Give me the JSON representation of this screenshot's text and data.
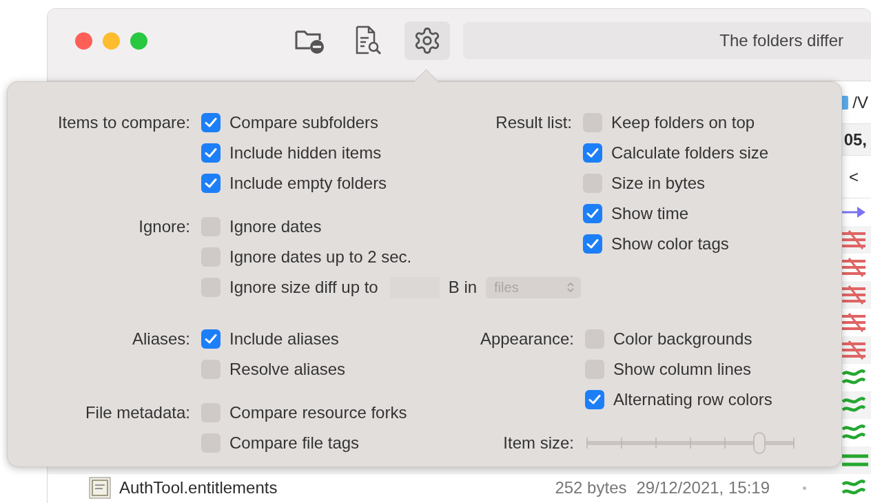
{
  "toolbar": {
    "buttons": [
      {
        "selected": false
      },
      {
        "selected": false
      },
      {
        "selected": true
      }
    ],
    "status": "The folders differ"
  },
  "background": {
    "path": "/V",
    "summary": "05,",
    "column_header": "<",
    "rows": [
      {
        "kind": "arrow"
      },
      {
        "kind": "different"
      },
      {
        "kind": "different"
      },
      {
        "kind": "different"
      },
      {
        "kind": "different"
      },
      {
        "kind": "different"
      },
      {
        "kind": "similar"
      },
      {
        "kind": "similar"
      },
      {
        "kind": "similar"
      },
      {
        "kind": "equal"
      },
      {
        "kind": "similar",
        "name": "AuthTool.entitlements",
        "size": "252 bytes",
        "date": "29/12/2021, 15:19"
      }
    ]
  },
  "popover": {
    "left": [
      {
        "label": "Items to compare:",
        "items": [
          {
            "kind": "checkbox",
            "label": "Compare subfolders",
            "checked": true
          },
          {
            "kind": "checkbox",
            "label": "Include hidden items",
            "checked": true
          },
          {
            "kind": "checkbox",
            "label": "Include empty folders",
            "checked": true
          }
        ]
      },
      {
        "label": "Ignore:",
        "items": [
          {
            "kind": "checkbox",
            "label": "Ignore dates",
            "checked": false
          },
          {
            "kind": "checkbox",
            "label": "Ignore dates up to 2 sec.",
            "checked": false
          },
          {
            "kind": "size",
            "label": "Ignore size diff up to",
            "checked": false,
            "unit": "B in",
            "select": {
              "value": "files",
              "disabled": true
            }
          }
        ]
      }
    ],
    "right": [
      {
        "label": "Result list:",
        "items": [
          {
            "kind": "checkbox",
            "label": "Keep folders on top",
            "checked": false
          },
          {
            "kind": "checkbox",
            "label": "Calculate folders size",
            "checked": true
          },
          {
            "kind": "checkbox",
            "label": "Size in bytes",
            "checked": false
          },
          {
            "kind": "checkbox",
            "label": "Show time",
            "checked": true
          },
          {
            "kind": "checkbox",
            "label": "Show color tags",
            "checked": true
          }
        ]
      }
    ],
    "left2": [
      {
        "label": "Aliases:",
        "items": [
          {
            "kind": "checkbox",
            "label": "Include aliases",
            "checked": true
          },
          {
            "kind": "checkbox",
            "label": "Resolve aliases",
            "checked": false
          }
        ]
      },
      {
        "label": "File metadata:",
        "items": [
          {
            "kind": "checkbox",
            "label": "Compare resource forks",
            "checked": false
          },
          {
            "kind": "checkbox",
            "label": "Compare file tags",
            "checked": false
          }
        ]
      }
    ],
    "right2": [
      {
        "label": "Appearance:",
        "items": [
          {
            "kind": "checkbox",
            "label": "Color backgrounds",
            "checked": false
          },
          {
            "kind": "checkbox",
            "label": "Show column lines",
            "checked": false
          },
          {
            "kind": "checkbox",
            "label": "Alternating row colors",
            "checked": true
          }
        ]
      },
      {
        "label": "Item size:",
        "items": [
          {
            "kind": "slider",
            "level": 0.833
          }
        ]
      }
    ]
  }
}
